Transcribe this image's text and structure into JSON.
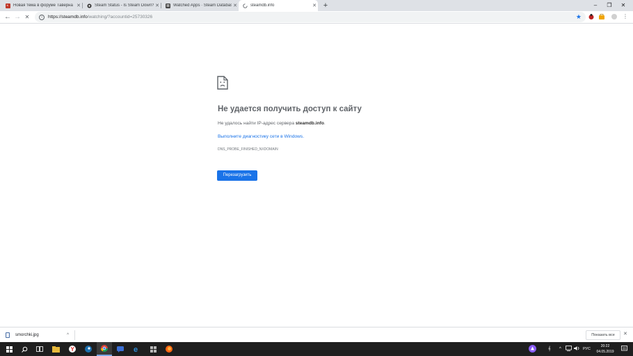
{
  "tabs": [
    {
      "title": "Новая тема в форуме Таверна",
      "icon": "forum-favicon"
    },
    {
      "title": "Steam Status - Is Steam Down?",
      "icon": "steam-gear-favicon"
    },
    {
      "title": "Watched Apps · Steam Database",
      "icon": "steamdb-favicon"
    },
    {
      "title": "steamdb.info",
      "icon": "loading-spinner-favicon",
      "active": true
    }
  ],
  "new_tab_label": "+",
  "window_controls": {
    "minimize": "–",
    "maximize": "❐",
    "close": "✕"
  },
  "toolbar": {
    "back": "←",
    "forward": "→",
    "reload": "✕",
    "url_host": "https://steamdb.info",
    "url_path": "/watching/?accountid=25730326",
    "bookmark_star": "★",
    "extensions_menu": "⋮"
  },
  "error_page": {
    "title": "Не удается получить доступ к сайту",
    "description_prefix": "Не удалось найти IP-адрес сервера ",
    "description_host": "steamdb.info",
    "description_suffix": ".",
    "diagnostics_link": "Выполните диагностику сети в Windows.",
    "error_code": "DNS_PROBE_FINISHED_NXDOMAIN",
    "reload_button": "Перезагрузить"
  },
  "download_shelf": {
    "file_name": "smorchki.jpg",
    "chevron": "^",
    "show_all": "Показать все",
    "close": "✕"
  },
  "taskbar": {
    "language": "РУС",
    "time": "20:22",
    "date": "04.05.2019",
    "tray_chevron": "^",
    "pinned_icons": [
      "windows-start-icon",
      "search-icon",
      "task-view-icon",
      "file-explorer-icon",
      "yandex-browser-icon",
      "steam-icon",
      "chrome-icon",
      "messenger-icon",
      "edge-icon",
      "app-grid-icon",
      "firefox-icon"
    ]
  },
  "colors": {
    "accent": "#1a73e8",
    "tabstrip": "#dee1e6",
    "taskbar": "#1f1f1f"
  }
}
